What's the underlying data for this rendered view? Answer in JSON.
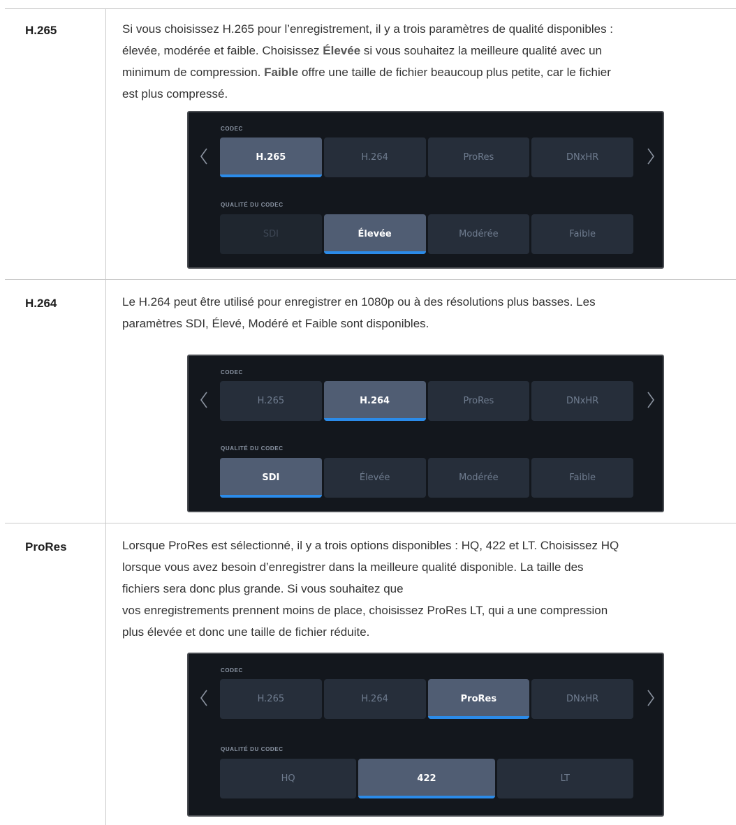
{
  "rows": [
    {
      "term": "H.265",
      "desc_lines": [
        [
          "Si vous choisissez H.265 pour l’enregistrement, il y a trois paramètres de qualité disponibles :"
        ],
        [
          "élevée, modérée et faible. Choisissez ",
          {
            "b": "Élevée"
          },
          " si vous souhaitez la meilleure qualité avec un"
        ],
        [
          "minimum de compression. ",
          {
            "b": "Faible"
          },
          " offre une taille de fichier beaucoup plus petite, car le fichier"
        ],
        [
          "est plus compressé."
        ]
      ],
      "panel": {
        "codec_label": "CODEC",
        "codecs": [
          "H.265",
          "H.264",
          "ProRes",
          "DNxHR"
        ],
        "codec_active": 0,
        "quality_label": "QUALITÉ DU CODEC",
        "qualities": [
          "SDI",
          "Élevée",
          "Modérée",
          "Faible"
        ],
        "quality_active": 1,
        "quality_dim": [
          0
        ]
      }
    },
    {
      "term": "H.264",
      "desc_lines": [
        [
          "Le H.264 peut être utilisé pour enregistrer en 1080p ou à des résolutions plus basses. Les"
        ],
        [
          "paramètres SDI, Élevé, Modéré et Faible sont disponibles."
        ]
      ],
      "panel": {
        "codec_label": "CODEC",
        "codecs": [
          "H.265",
          "H.264",
          "ProRes",
          "DNxHR"
        ],
        "codec_active": 1,
        "quality_label": "QUALITÉ DU CODEC",
        "qualities": [
          "SDI",
          "Élevée",
          "Modérée",
          "Faible"
        ],
        "quality_active": 0,
        "quality_dim": []
      }
    },
    {
      "term": "ProRes",
      "desc_lines": [
        [
          "Lorsque ProRes est sélectionné, il y a trois options disponibles : HQ, 422 et LT. Choisissez HQ"
        ],
        [
          "lorsque vous avez besoin d’enregistrer dans la meilleure qualité disponible. La taille des"
        ],
        [
          "fichiers sera donc plus grande. Si vous souhaitez que"
        ],
        [
          "vos enregistrements prennent moins de place, choisissez ProRes LT, qui a une compression"
        ],
        [
          "plus élevée et donc une taille de fichier réduite."
        ]
      ],
      "panel": {
        "codec_label": "CODEC",
        "codecs": [
          "H.265",
          "H.264",
          "ProRes",
          "DNxHR"
        ],
        "codec_active": 2,
        "quality_label": "QUALITÉ DU CODEC",
        "qualities": [
          "HQ",
          "422",
          "LT"
        ],
        "quality_active": 1,
        "quality_dim": []
      }
    }
  ]
}
